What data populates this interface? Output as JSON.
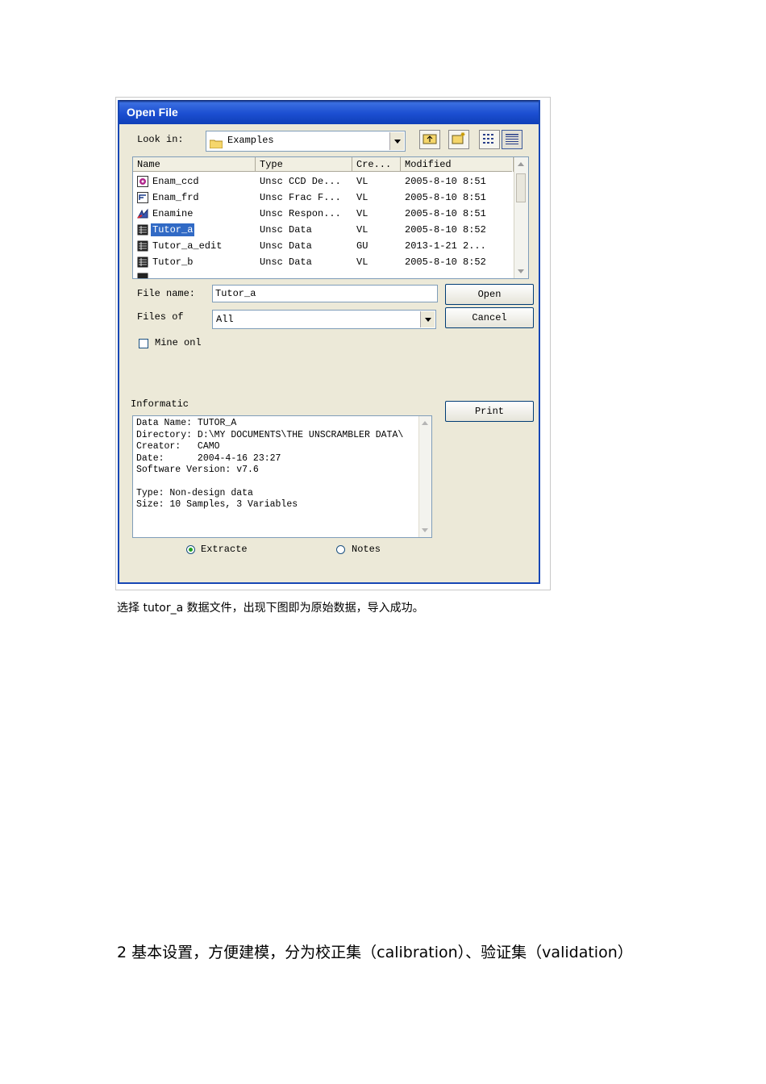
{
  "dialog": {
    "title": "Open File",
    "look_in_label": "Look in:",
    "look_in_value": "Examples",
    "columns": [
      "Name",
      "Type",
      "Cre...",
      "Modified"
    ],
    "files": [
      {
        "name": "Enam_ccd",
        "type": "Unsc CCD De...",
        "creator": "VL",
        "modified": "2005-8-10 8:51",
        "icon": "ccd-file-icon"
      },
      {
        "name": "Enam_frd",
        "type": "Unsc Frac F...",
        "creator": "VL",
        "modified": "2005-8-10 8:51",
        "icon": "frac-file-icon"
      },
      {
        "name": "Enamine",
        "type": "Unsc Respon...",
        "creator": "VL",
        "modified": "2005-8-10 8:51",
        "icon": "response-file-icon"
      },
      {
        "name": "Tutor_a",
        "type": "Unsc Data",
        "creator": "VL",
        "modified": "2005-8-10 8:52",
        "icon": "data-file-icon"
      },
      {
        "name": "Tutor_a_edit",
        "type": "Unsc Data",
        "creator": "GU",
        "modified": "2013-1-21 2...",
        "icon": "data-file-icon"
      },
      {
        "name": "Tutor_b",
        "type": "Unsc Data",
        "creator": "VL",
        "modified": "2005-8-10 8:52",
        "icon": "data-file-icon"
      }
    ],
    "file_name_label": "File name:",
    "file_name_value": "Tutor_a",
    "files_of_label": "Files of",
    "files_of_value": "All",
    "open_label": "Open",
    "cancel_label": "Cancel",
    "mine_only_label": "Mine onl",
    "information_label": "Informatic",
    "print_label": "Print",
    "info_lines": [
      "Data Name: TUTOR_A",
      "Directory: D:\\MY DOCUMENTS\\THE UNSCRAMBLER DATA\\",
      "Creator:   CAMO",
      "Date:      2004-4-16 23:27",
      "Software Version: v7.6",
      "",
      "Type: Non-design data",
      "Size: 10 Samples, 3 Variables"
    ],
    "radio_extracted": "Extracte",
    "radio_notes": "Notes"
  },
  "caption": "选择 tutor_a 数据文件，出现下图即为原始数据，导入成功。",
  "section_heading": "2   基本设置，方便建模，分为校正集（calibration）、验证集（validation）",
  "colors": {
    "title_bar": "#1c4fd2",
    "selection": "#316ac5",
    "dialog_bg": "#ece9d8"
  }
}
